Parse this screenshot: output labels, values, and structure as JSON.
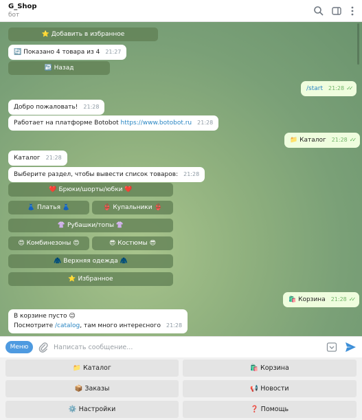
{
  "header": {
    "title": "G_Shop",
    "subtitle": "бот"
  },
  "top_buttons": {
    "favorites": "⭐ Добавить в избранное",
    "back": "↩️ Назад"
  },
  "shown_msg": {
    "icon": "🔄",
    "text": "Показано 4 товара из 4",
    "time": "21:27"
  },
  "start_msg": {
    "text": "/start",
    "time": "21:28"
  },
  "welcome_msg": {
    "text": "Добро пожаловать!",
    "time": "21:28"
  },
  "platform_msg": {
    "text": "Работает на платформе Botobot ",
    "link": "https://www.botobot.ru",
    "time": "21:28"
  },
  "catalog_out": {
    "text": "📁 Каталог",
    "time": "21:28"
  },
  "catalog_in": {
    "text": "Каталог",
    "time": "21:28"
  },
  "section_msg": {
    "text": "Выберите раздел, чтобы вывести список товаров:",
    "time": "21:28"
  },
  "catalog_buttons": {
    "pants": "❤️ Брюки/шорты/юбки ❤️",
    "dresses": "👗 Платья 👗",
    "swimwear": "👙 Купальники 👙",
    "shirts": "👚 Рубашки/топы 👚",
    "overalls": "😍 Комбинезоны 😍",
    "suits": "😎 Костюмы 😎",
    "outerwear": "🧥 Верхняя одежда 🧥",
    "favorites": "⭐ Избранное"
  },
  "cart_out": {
    "text": "🛍️ Корзина",
    "time": "21:28"
  },
  "cart_msg": {
    "line1": "В корзине пусто 😉",
    "line2_prefix": "Посмотрите ",
    "line2_link": "/catalog",
    "line2_suffix": ", там много интересного",
    "time": "21:28"
  },
  "composer": {
    "menu_label": "Меню",
    "placeholder": "Написать сообщение..."
  },
  "keyboard": {
    "catalog": "📁 Каталог",
    "cart": "🛍️ Корзина",
    "orders": "📦 Заказы",
    "news": "📢 Новости",
    "settings": "⚙️ Настройки",
    "help": "❓ Помощь"
  },
  "colors": {
    "accent": "#4e9ae0",
    "outgoing_bubble": "#effdde",
    "inline_button": "#628054"
  }
}
